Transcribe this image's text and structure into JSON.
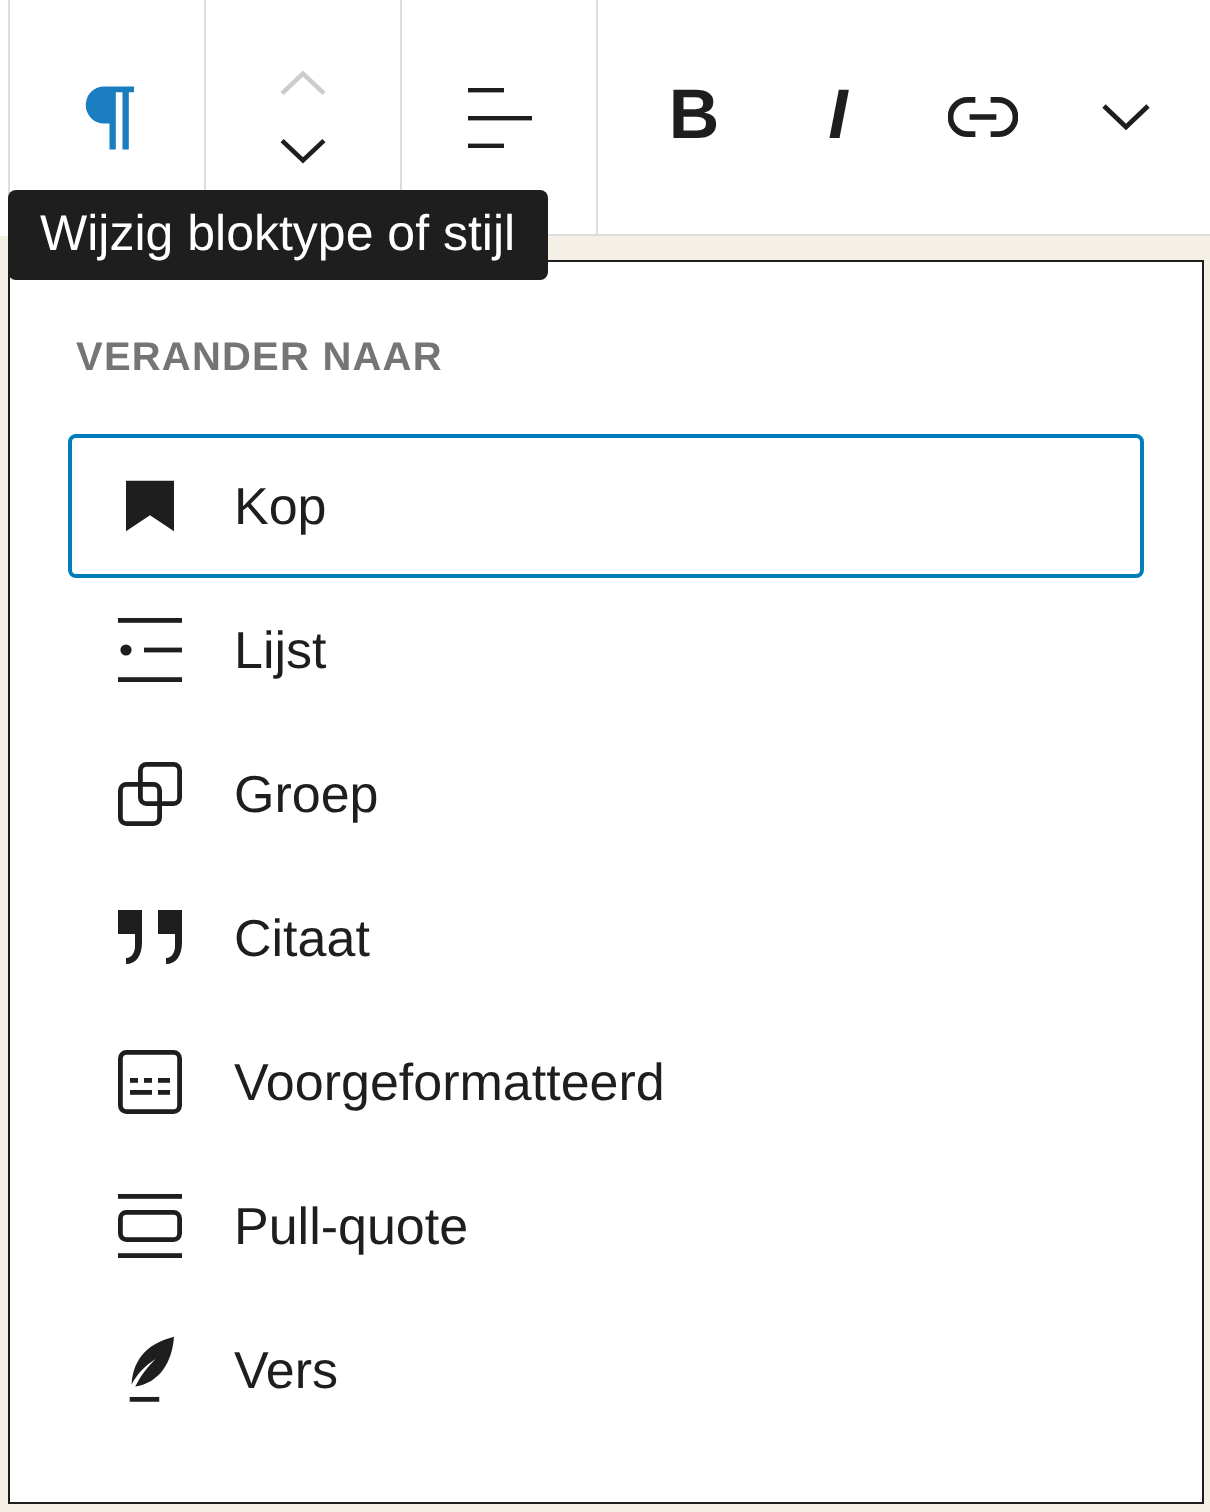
{
  "toolbar": {
    "groups": [
      {
        "buttons": [
          {
            "kind": "paragraph",
            "active": true
          }
        ]
      },
      {
        "buttons": [
          {
            "kind": "move-up",
            "disabled": true
          },
          {
            "kind": "move-down",
            "disabled": false
          }
        ]
      },
      {
        "buttons": [
          {
            "kind": "align"
          }
        ]
      },
      {
        "buttons": [
          {
            "kind": "bold",
            "label": "B"
          },
          {
            "kind": "italic",
            "label": "I"
          },
          {
            "kind": "link"
          },
          {
            "kind": "more"
          }
        ]
      }
    ]
  },
  "tooltip": {
    "text": "Wijzig bloktype of stijl"
  },
  "popover": {
    "heading": "VERANDER NAAR",
    "items": [
      {
        "kind": "heading",
        "label": "Kop",
        "selected": true
      },
      {
        "kind": "list",
        "label": "Lijst",
        "selected": false
      },
      {
        "kind": "group",
        "label": "Groep",
        "selected": false
      },
      {
        "kind": "quote",
        "label": "Citaat",
        "selected": false
      },
      {
        "kind": "preformatted",
        "label": "Voorgeformatteerd",
        "selected": false
      },
      {
        "kind": "pullquote",
        "label": "Pull-quote",
        "selected": false
      },
      {
        "kind": "verse",
        "label": "Vers",
        "selected": false
      }
    ]
  }
}
